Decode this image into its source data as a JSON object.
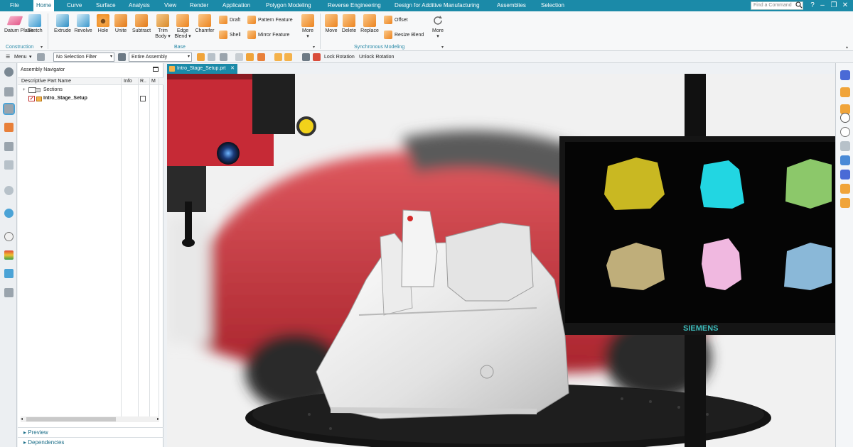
{
  "menubar": {
    "items": [
      "File",
      "Home",
      "Curve",
      "Surface",
      "Analysis",
      "View",
      "Render",
      "Application",
      "Polygon Modeling",
      "Reverse Engineering",
      "Design for Additive Manufacturing",
      "Assemblies",
      "Selection"
    ],
    "active": "Home",
    "search_placeholder": "Find a Command"
  },
  "ribbon": {
    "construction": {
      "datum_plane": "Datum Plane",
      "sketch": "Sketch",
      "group": "Construction"
    },
    "base": {
      "extrude": "Extrude",
      "revolve": "Revolve",
      "hole": "Hole",
      "unite": "Unite",
      "subtract": "Subtract",
      "trim_body": "Trim Body",
      "edge_blend": "Edge Blend",
      "chamfer": "Chamfer",
      "draft": "Draft",
      "shell": "Shell",
      "pattern_feature": "Pattern Feature",
      "mirror_feature": "Mirror Feature",
      "more": "More",
      "group": "Base"
    },
    "sync": {
      "move": "Move",
      "delete": "Delete",
      "replace": "Replace",
      "offset": "Offset",
      "resize_blend": "Resize Blend",
      "more": "More",
      "group": "Synchronous Modeling"
    }
  },
  "toolbar": {
    "menu": "Menu",
    "selection_filter": "No Selection Filter",
    "scope": "Entire Assembly",
    "lock_rotation": "Lock Rotation",
    "unlock_rotation": "Unlock Rotation"
  },
  "navigator": {
    "title": "Assembly Navigator",
    "columns": [
      "Descriptive Part Name",
      "Info",
      "R..",
      "M"
    ],
    "rows": [
      {
        "name": "Sections"
      },
      {
        "name": "Intro_Stage_Setup"
      }
    ],
    "sections": [
      "Preview",
      "Dependencies"
    ]
  },
  "document": {
    "tab": "Intro_Stage_Setup.prt"
  },
  "viewport": {
    "monitor_brand": "SIEMENS"
  },
  "colors": {
    "accent": "#1b8aa8",
    "part_gray": "#e6e6e6",
    "car_red": "#c8323c"
  }
}
